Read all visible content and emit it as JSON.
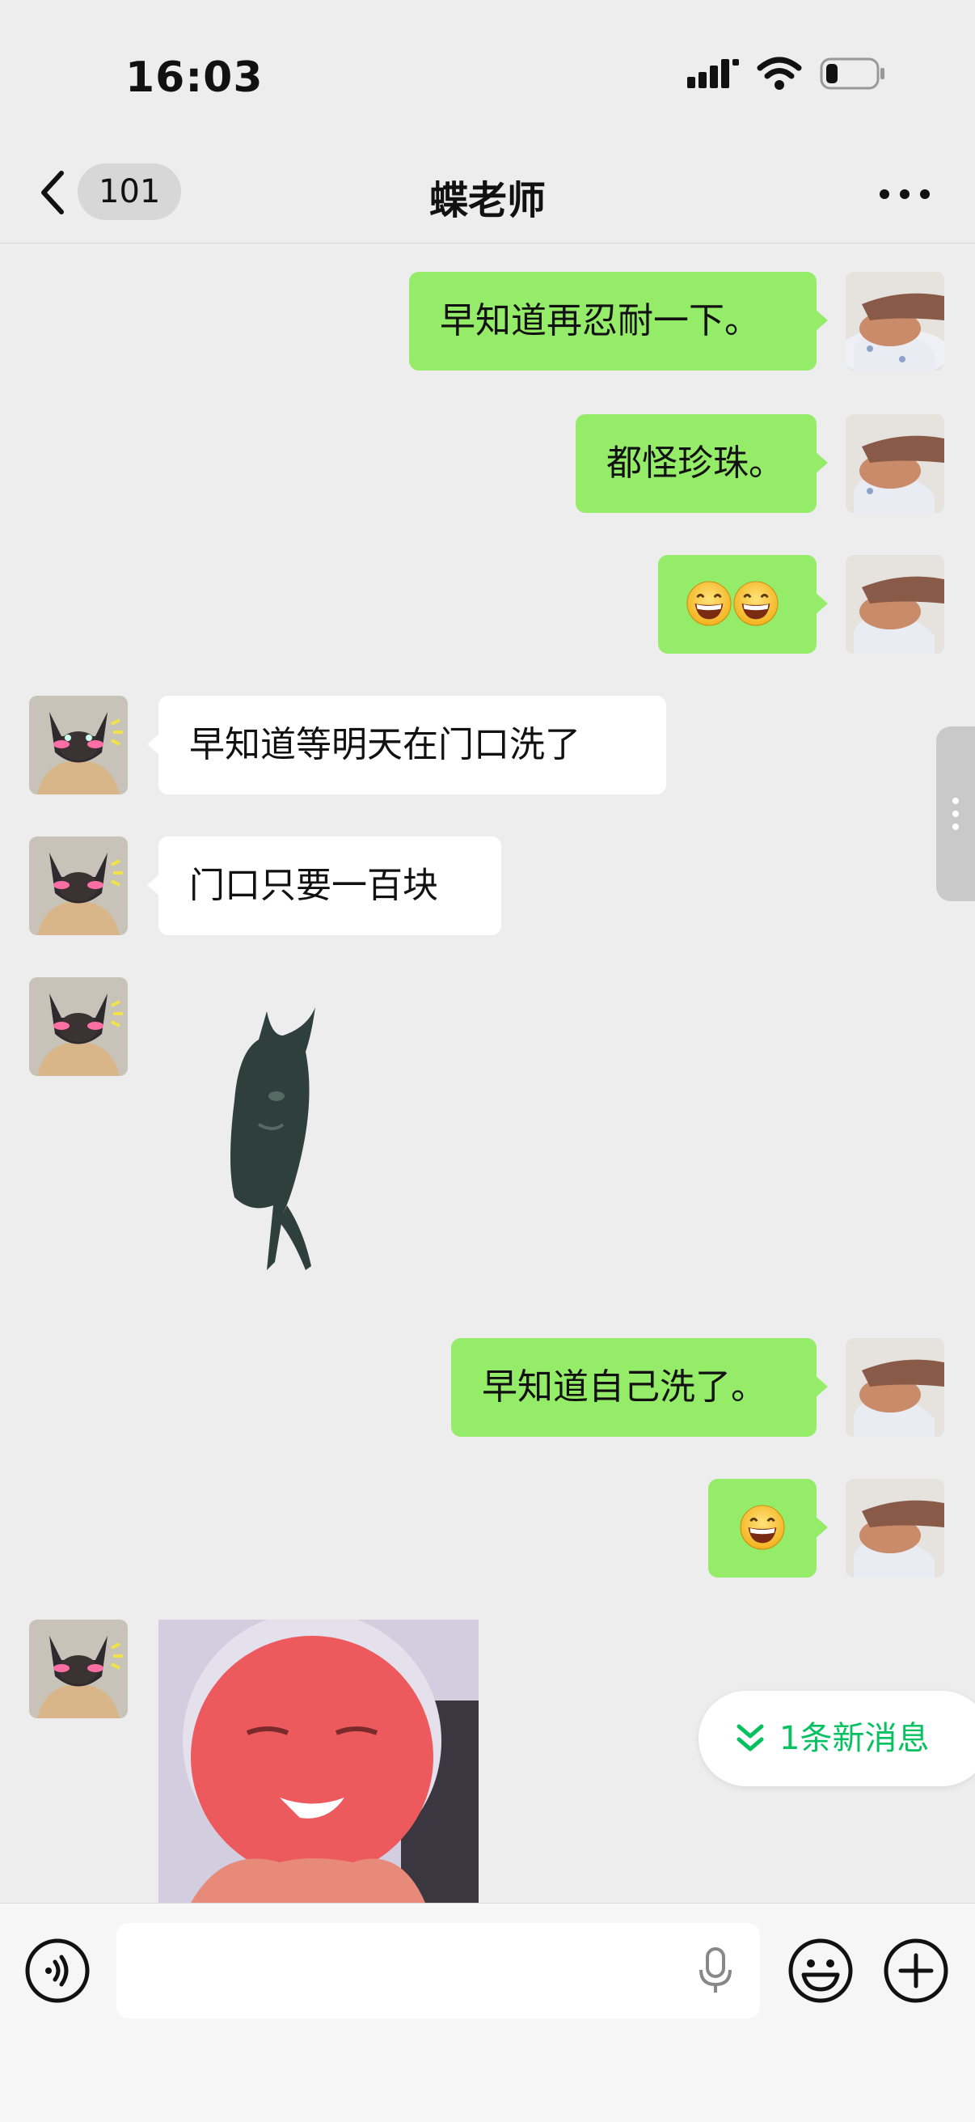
{
  "status_bar": {
    "time": "16:03"
  },
  "nav": {
    "back_count": "101",
    "title": "蝶老师"
  },
  "messages": [
    {
      "dir": "out",
      "type": "text",
      "text": "早知道再忍耐一下。"
    },
    {
      "dir": "out",
      "type": "text",
      "text": "都怪珍珠。"
    },
    {
      "dir": "out",
      "type": "emoji",
      "emoji": [
        "grinning-face-icon",
        "grinning-face-icon"
      ]
    },
    {
      "dir": "in",
      "type": "text",
      "text": "早知道等明天在门口洗了"
    },
    {
      "dir": "in",
      "type": "text",
      "text": "门口只要一百块"
    },
    {
      "dir": "in",
      "type": "sticker",
      "sticker": "dancing-dark-figure-sticker"
    },
    {
      "dir": "out",
      "type": "text",
      "text": "早知道自己洗了。"
    },
    {
      "dir": "out",
      "type": "emoji",
      "emoji": [
        "grinning-face-icon"
      ]
    },
    {
      "dir": "in",
      "type": "sticker",
      "sticker": "pink-face-sticker"
    }
  ],
  "new_messages_pill": {
    "label": "1条新消息"
  },
  "input_bar": {
    "value": "",
    "placeholder": ""
  },
  "colors": {
    "accent_green": "#07c160",
    "bubble_out": "#95ec69",
    "bubble_in": "#ffffff",
    "background": "#ededed"
  }
}
